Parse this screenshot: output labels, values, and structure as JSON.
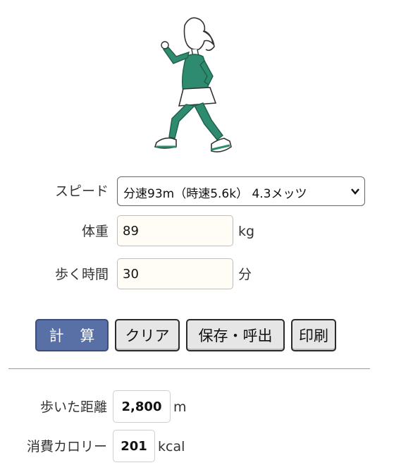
{
  "illustration": {
    "name": "walking-woman-illustration",
    "accent": "#2e8b6f"
  },
  "form": {
    "speed": {
      "label": "スピード",
      "selected": "分速93m（時速5.6k） 4.3メッツ"
    },
    "weight": {
      "label": "体重",
      "value": "89",
      "unit": "kg"
    },
    "time": {
      "label": "歩く時間",
      "value": "30",
      "unit": "分"
    }
  },
  "buttons": {
    "calculate": "計 算",
    "clear": "クリア",
    "save_load": "保存・呼出",
    "print": "印刷"
  },
  "results": {
    "distance": {
      "label": "歩いた距離",
      "value": "2,800",
      "unit": "m"
    },
    "calories": {
      "label": "消費カロリー",
      "value": "201",
      "unit": "kcal"
    }
  },
  "colors": {
    "primary_button": "#5870a6",
    "input_bg": "#fffdf6",
    "figure_green": "#2e8b6f"
  }
}
